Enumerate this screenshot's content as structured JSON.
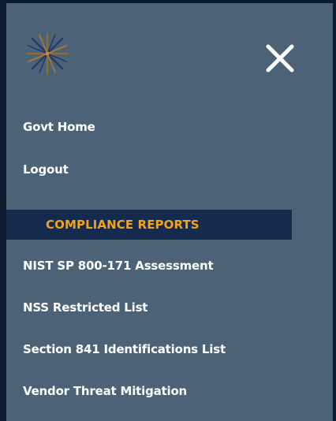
{
  "menu": {
    "logo_icon": "starburst-logo-icon",
    "close_icon": "close-icon",
    "colors": {
      "panel_background": "#4b6277",
      "page_background": "#0d1b2f",
      "section_header_background": "#152b4d",
      "section_header_text": "#f2a21c",
      "link_text": "#ffffff"
    },
    "top_links": [
      {
        "label": "Govt Home"
      },
      {
        "label": "Logout"
      }
    ],
    "compliance_section": {
      "title": "COMPLIANCE REPORTS",
      "links": [
        {
          "label": "NIST SP 800-171 Assessment"
        },
        {
          "label": "NSS Restricted List"
        },
        {
          "label": "Section 841 Identifications List"
        },
        {
          "label": "Vendor Threat Mitigation"
        }
      ]
    }
  }
}
